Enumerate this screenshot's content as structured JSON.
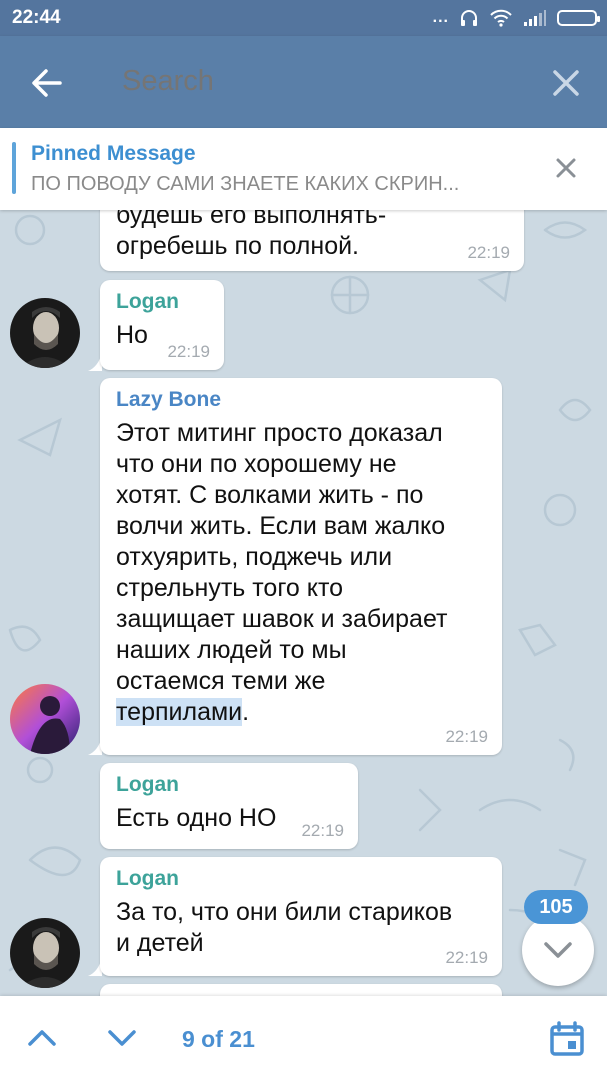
{
  "status_bar": {
    "time": "22:44",
    "indicators": "...",
    "icons": [
      "headphones-icon",
      "wifi-icon",
      "signal-icon",
      "battery-icon"
    ]
  },
  "toolbar": {
    "search_placeholder": "Search",
    "icons": [
      "back-arrow-icon",
      "close-icon"
    ]
  },
  "pinned": {
    "title": "Pinned Message",
    "text": "ПО ПОВОДУ САМИ ЗНАЕТЕ КАКИХ СКРИН..."
  },
  "messages": [
    {
      "sender": "",
      "text_lines": [
        "будешь его выполнять-",
        "огребешь по полной."
      ],
      "time": "22:19"
    },
    {
      "sender": "Logan",
      "text_lines": [
        "Но"
      ],
      "time": "22:19"
    },
    {
      "sender": "Lazy Bone",
      "text_lines": [
        "Этот митинг просто доказал",
        "что они по хорошему не",
        "хотят. С волками жить - по",
        "волчи жить. Если вам жалко",
        "отхуярить, поджечь или",
        "стрельнуть того кто",
        "защищает шавок и забирает",
        "наших людей то мы",
        "остаемся теми же"
      ],
      "highlight": "терпилами",
      "after_highlight": ".",
      "time": "22:19"
    },
    {
      "sender": "Logan",
      "text_lines": [
        "Есть одно НО"
      ],
      "time": "22:19"
    },
    {
      "sender": "Logan",
      "text_lines": [
        "За то, что они били стариков",
        "и детей"
      ],
      "time": "22:19"
    }
  ],
  "unread_badge": "105",
  "bottom_bar": {
    "counter": "9 of 21",
    "icons": [
      "chevron-up-icon",
      "chevron-down-icon",
      "calendar-icon"
    ]
  },
  "colors": {
    "header": "#5a7fa8",
    "status_bar": "#54759e",
    "accent": "#4a8fd1",
    "chat_background": "#ccd9e2"
  }
}
